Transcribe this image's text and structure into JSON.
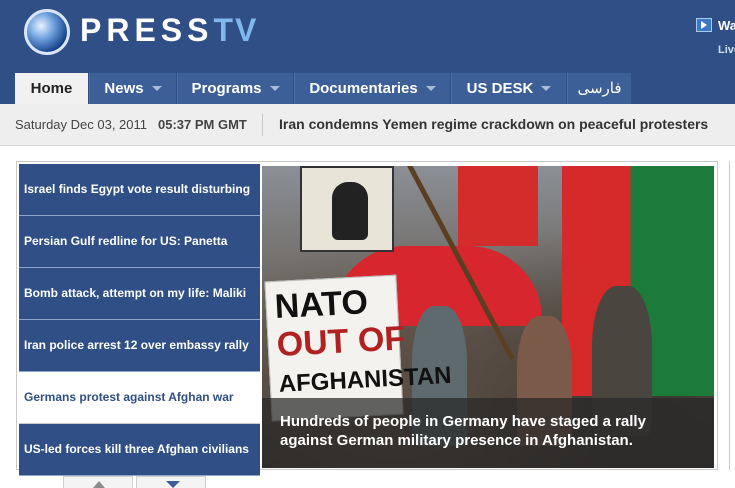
{
  "header": {
    "logo_main": "PRESS",
    "logo_accent": "TV",
    "watch_label": "Wa",
    "live_label": "Live"
  },
  "nav": {
    "items": [
      {
        "label": "Home",
        "active": true,
        "dropdown": false
      },
      {
        "label": "News",
        "active": false,
        "dropdown": true
      },
      {
        "label": "Programs",
        "active": false,
        "dropdown": true
      },
      {
        "label": "Documentaries",
        "active": false,
        "dropdown": true
      },
      {
        "label": "US DESK",
        "active": false,
        "dropdown": true
      },
      {
        "label": "فارسی",
        "active": false,
        "dropdown": false
      }
    ]
  },
  "datebar": {
    "date": "Saturday Dec 03, 2011",
    "time": "05:37 PM GMT",
    "ticker": "Iran condemns Yemen regime crackdown on peaceful protesters"
  },
  "slider": {
    "stories": [
      {
        "title": "Israel finds Egypt vote result disturbing",
        "active": false
      },
      {
        "title": "Persian Gulf redline for US: Panetta",
        "active": false
      },
      {
        "title": "Bomb attack, attempt on my life: Maliki",
        "active": false
      },
      {
        "title": "Iran police arrest 12 over embassy rally",
        "active": false
      },
      {
        "title": "Germans protest against Afghan war",
        "active": true
      },
      {
        "title": "US-led forces kill three Afghan civilians",
        "active": false
      }
    ],
    "caption_line1": "Hundreds of people in Germany have staged a rally",
    "caption_line2": "against German military presence in Afghanistan.",
    "sign_text": {
      "line1": "NATO",
      "line2": "OUT OF",
      "line3": "AFGHANISTAN"
    }
  },
  "colors": {
    "brand_blue": "#2f4f86",
    "accent_light_blue": "#7fb8ec",
    "active_tab_bg": "#f1f1f1"
  },
  "icons": {
    "play": "play-icon",
    "arrow_up": "arrow-up-icon",
    "arrow_down": "arrow-down-icon"
  }
}
